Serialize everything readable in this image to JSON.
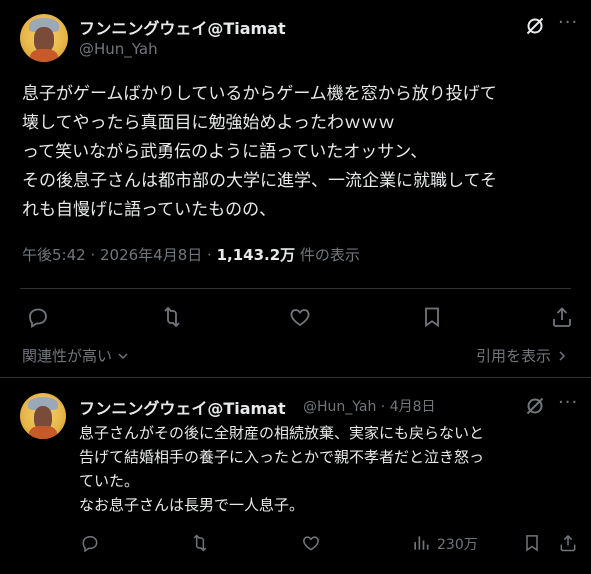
{
  "main_tweet": {
    "author_name": "フンニングウェイ@Tiamat",
    "author_handle": "@Hun_Yah",
    "text_lines": [
      "息子がゲームばかりしているからゲーム機を窓から放り投げて",
      "壊してやったら真面目に勉強始めよったわｗｗｗ",
      "って笑いながら武勇伝のように語っていたオッサン、",
      "その後息子さんは都市部の大学に進学、一流企業に就職してそ",
      "れも自慢げに語っていたものの、"
    ],
    "time": "午後5:42 · 2026年4月8日 · ",
    "views_count": "1,143.2万",
    "views_label": " 件の表示",
    "sort_label": "関連性が高い",
    "quotes_label": "引用を表示"
  },
  "reply": {
    "author_name": "フンニングウェイ@Tiamat",
    "author_handle_date": "@Hun_Yah · 4月8日",
    "text_lines": [
      "息子さんがその後に全財産の相続放棄、実家にも戻らないと",
      "告げて結婚相手の養子に入ったとかで親不孝者だと泣き怒っ",
      "ていた。",
      "なお息子さんは長男で一人息子。"
    ],
    "views": "230万"
  },
  "icons": {
    "grok": "grok-icon",
    "more": "more-icon",
    "reply": "reply-icon",
    "retweet": "retweet-icon",
    "like": "like-icon",
    "bookmark": "bookmark-icon",
    "share": "share-icon",
    "views": "views-icon"
  },
  "colors": {
    "background": "#000000",
    "text": "#e7e9ea",
    "secondary": "#71767b",
    "divider": "#2f3336"
  }
}
